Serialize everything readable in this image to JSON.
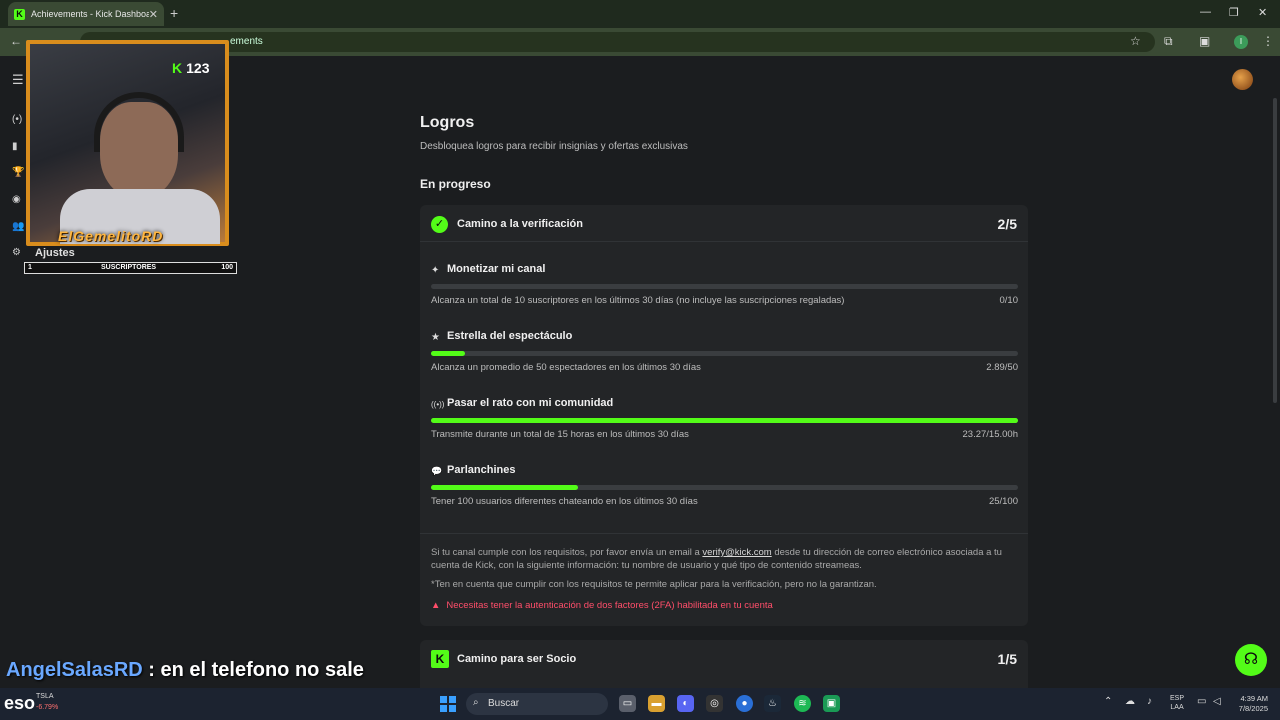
{
  "browser": {
    "tab_title": "Achievements - Kick Dashboard",
    "favicon": "K",
    "close": "✕",
    "new_tab": "+",
    "url": "ements",
    "window_buttons": [
      "—",
      "❐",
      "✕"
    ],
    "profile": "I"
  },
  "sidebar": {
    "items": [
      "(•)",
      "▮",
      "🏆",
      "◉",
      "👥"
    ],
    "settings_label": "Ajustes",
    "settings_icon": "⚙"
  },
  "overlay": {
    "kick_count": "123",
    "brand": "ElGemelitoRD",
    "sub_bar": {
      "min": "1",
      "label": "SUSCRIPTORES",
      "max": "100"
    }
  },
  "page": {
    "title": "Logros",
    "subtitle": "Desbloquea logros para recibir insignias y ofertas exclusivas",
    "section": "En progreso"
  },
  "card1": {
    "title": "Camino a la verificación",
    "count": "2/5",
    "goals": [
      {
        "icon": "✦",
        "title": "Monetizar mi canal",
        "desc": "Alcanza un total de 10 suscriptores en los últimos 30 días (no incluye las suscripciones regaladas)",
        "value": "0/10",
        "progress": 0.0
      },
      {
        "icon": "★",
        "title": "Estrella del espectáculo",
        "desc": "Alcanza un promedio de 50 espectadores en los últimos 30 días",
        "value": "2.89/50",
        "progress": 0.058
      },
      {
        "icon": "((•))",
        "title": "Pasar el rato con mi comunidad",
        "desc": "Transmite durante un total de 15 horas en los últimos 30 días",
        "value": "23.27/15.00h",
        "progress": 1.0
      },
      {
        "icon": "💬",
        "title": "Parlanchines",
        "desc": "Tener 100 usuarios diferentes chateando en los últimos 30 días",
        "value": "25/100",
        "progress": 0.25
      }
    ],
    "info_pre": "Si tu canal cumple con los requisitos, por favor envía un email a ",
    "info_link": "verify@kick.com",
    "info_post": " desde tu dirección de correo electrónico asociada a tu cuenta de Kick, con la siguiente información: tu nombre de usuario y qué tipo de contenido streameas.",
    "note": "*Ten en cuenta que cumplir con los requisitos te permite aplicar para la verificación, pero no la garantizan.",
    "warning": "Necesitas tener la autenticación de dos factores (2FA) habilitada en tu cuenta"
  },
  "card2": {
    "title": "Camino para ser Socio",
    "count": "1/5"
  },
  "chat": {
    "user": "AngelSalasRD",
    "message": " : en el telefono no sale"
  },
  "taskbar": {
    "widget_text": "eso",
    "ticker": "TSLA",
    "ticker_change": "-6.79%",
    "search_placeholder": "Buscar",
    "lang_top": "ESP",
    "lang_bottom": "LAA",
    "time": "4:39 AM",
    "date": "7/8/2025"
  },
  "colors": {
    "accent": "#53fc18",
    "warning": "#ff4e6a"
  }
}
